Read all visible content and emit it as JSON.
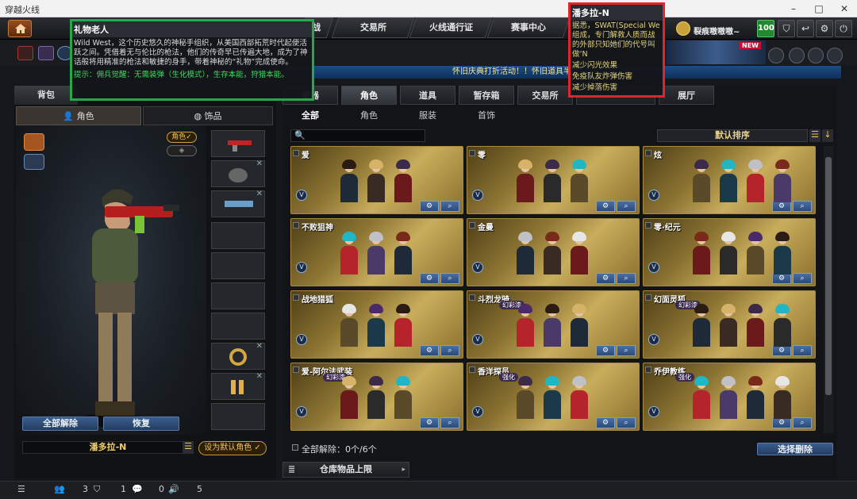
{
  "window": {
    "title": "穿越火线"
  },
  "nav": {
    "tabs": [
      "交易所",
      "火线通行证",
      "赛事中心"
    ],
    "player_name": "裂痕嗷嗷嗷~",
    "level": "100",
    "truncated_left": "战"
  },
  "ticker": {
    "text": "怀旧庆典打折活动！！怀旧道具半价"
  },
  "left": {
    "top_tabs": [
      "背包"
    ],
    "subtabs": [
      "角色",
      "饰品"
    ],
    "tags": [
      "角色",
      "✓"
    ],
    "clear_all": "全部解除",
    "restore": "恢复",
    "char_name": "潘多拉-N",
    "set_default": "设为默认角色"
  },
  "main": {
    "tabs": [
      "武器",
      "角色",
      "道具",
      "暂存箱",
      "交易所",
      "",
      "展厅"
    ],
    "filters": [
      "全部",
      "角色",
      "服装",
      "首饰"
    ],
    "sort_label": "默认排序",
    "cards": [
      {
        "name": "爱",
        "tag": ""
      },
      {
        "name": "零",
        "tag": ""
      },
      {
        "name": "炫",
        "tag": ""
      },
      {
        "name": "不败狙神",
        "tag": ""
      },
      {
        "name": "金曼",
        "tag": ""
      },
      {
        "name": "零·纪元",
        "tag": ""
      },
      {
        "name": "战地猎狐",
        "tag": ""
      },
      {
        "name": "斗烈龙骑",
        "tag": "幻彩漆"
      },
      {
        "name": "幻面灵狐",
        "tag": "幻彩漆"
      },
      {
        "name": "爱-阿尔法武装",
        "tag": "幻彩漆"
      },
      {
        "name": "香洋探员",
        "tag": "强化"
      },
      {
        "name": "乔伊教练",
        "tag": "强化"
      }
    ],
    "clear_count": "全部解除：0个/6个",
    "clear_button": "选择删除",
    "capacity_label": "仓库物品上限"
  },
  "status": {
    "values": [
      "3",
      "1",
      "0",
      "5"
    ]
  },
  "tooltip_gift": {
    "title": "礼物老人",
    "body": "Wild West，这个历史悠久的神秘手组织，从美国西部拓荒时代起便活跃之间。凭借着无与伦比的枪法，他们的传奇早已传遍大地，成为了神话般将用精准的枪法和敏捷的身手，带着神秘的“礼物”完成使命。",
    "hint": "提示：佣兵觉醒：无需装弹（生化模式），生存本能，狩猎本能。"
  },
  "tooltip_char": {
    "title": "潘多拉-N",
    "body": "据悉，SWAT(Special We组成，专门解救人质而战的外部只知她们的代号叫做‘N",
    "effects": [
      "减少闪光效果",
      "免疫队友炸弹伤害",
      "减少掉落伤害"
    ]
  }
}
